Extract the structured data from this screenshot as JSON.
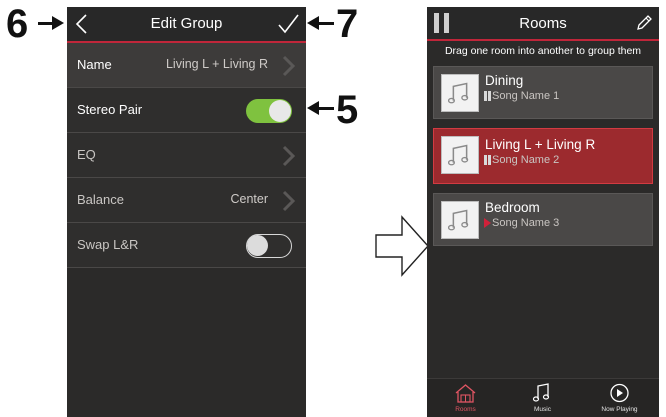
{
  "callouts": {
    "six": "6",
    "seven": "7",
    "five": "5"
  },
  "left_screen": {
    "title": "Edit Group",
    "back_icon": "chevron-left-icon",
    "confirm_icon": "checkmark-icon",
    "rows": [
      {
        "label": "Name",
        "value": "Living L + Living R",
        "chevron": true
      },
      {
        "label": "Stereo Pair",
        "toggle": "on"
      },
      {
        "label": "EQ",
        "chevron": true
      },
      {
        "label": "Balance",
        "value": "Center",
        "chevron": true
      },
      {
        "label": "Swap L&R",
        "toggle": "off"
      }
    ]
  },
  "right_screen": {
    "title": "Rooms",
    "left_icon": "pause-icon",
    "right_icon": "pencil-icon",
    "hint": "Drag one room into another to group them",
    "rooms": [
      {
        "name": "Dining",
        "song": "Song Name 1",
        "state": "paused",
        "selected": false
      },
      {
        "name": "Living L + Living R",
        "song": "Song Name 2",
        "state": "paused",
        "selected": true
      },
      {
        "name": "Bedroom",
        "song": "Song Name 3",
        "state": "playing",
        "selected": false
      }
    ],
    "tabs": [
      {
        "label": "Rooms",
        "icon": "house-icon",
        "active": true
      },
      {
        "label": "Music",
        "icon": "music-note-icon",
        "active": false
      },
      {
        "label": "Now Playing",
        "icon": "play-circle-icon",
        "active": false
      }
    ]
  },
  "colors": {
    "accent_red": "#c0263a",
    "toggle_green": "#7fc23f",
    "selected_card": "#9c2a2e",
    "screen_bg": "#2b2a29"
  }
}
